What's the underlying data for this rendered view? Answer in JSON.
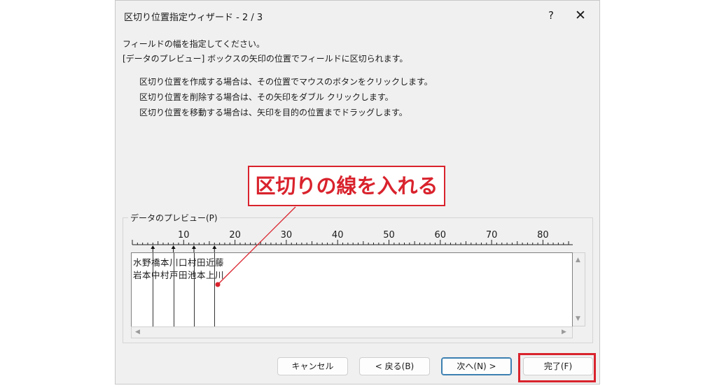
{
  "dialog": {
    "title": "区切り位置指定ウィザード - 2 / 3",
    "help_label": "?",
    "close_label": "✕",
    "instructions": [
      "フィールドの幅を指定してください。",
      "[データのプレビュー] ボックスの矢印の位置でフィールドに区切られます。",
      "区切り位置を作成する場合は、その位置でマウスのボタンをクリックします。",
      "区切り位置を削除する場合は、その矢印をダブル クリックします。",
      "区切り位置を移動する場合は、矢印を目的の位置までドラッグします。"
    ],
    "preview": {
      "label": "データのプレビュー(P)",
      "ruler_ticks": [
        "10",
        "20",
        "30",
        "40",
        "50",
        "60",
        "70",
        "80"
      ],
      "rows": [
        "水野橋本川口村田近藤",
        "岩本中村戸田池本上川"
      ],
      "break_columns": [
        4,
        8,
        12,
        16
      ]
    },
    "buttons": {
      "cancel": "キャンセル",
      "back": "< 戻る(B)",
      "next": "次へ(N) >",
      "finish": "完了(F)"
    }
  },
  "annotation": {
    "callout_text": "区切りの線を入れる",
    "accent_color": "#d9232d"
  }
}
